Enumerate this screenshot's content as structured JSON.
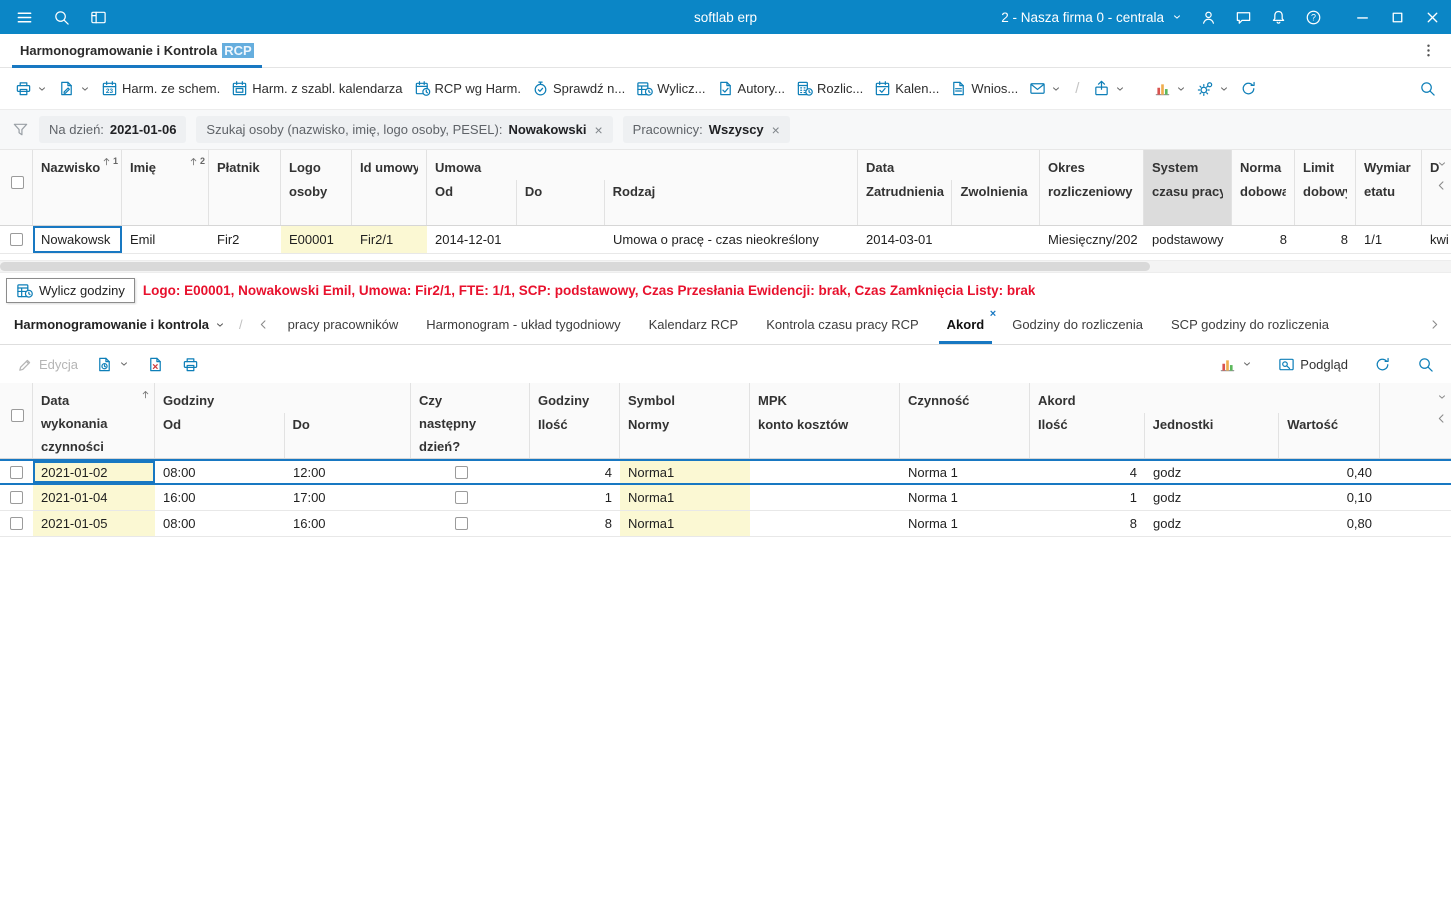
{
  "topbar": {
    "title": "softlab erp",
    "company_selector": "2 - Nasza firma 0 - centrala"
  },
  "window_tab": {
    "label": "Harmonogramowanie i Kontrola",
    "label_highlight": "RCP"
  },
  "toolbar1": {
    "buttons": [
      {
        "name": "print",
        "icon": "printer",
        "label": "",
        "caret": true
      },
      {
        "name": "export",
        "icon": "page-edit",
        "label": "",
        "caret": true
      },
      {
        "name": "harm-ze-schem",
        "icon": "calendar-23",
        "label": "Harm. ze schem.",
        "caret": false
      },
      {
        "name": "harm-z-szabl-kalendarza",
        "icon": "calendar-template",
        "label": "Harm. z szabl. kalendarza",
        "caret": false
      },
      {
        "name": "rcp-wg-harm",
        "icon": "calendar-clock",
        "label": "RCP wg Harm.",
        "caret": false
      },
      {
        "name": "sprawdz",
        "icon": "stopwatch-check",
        "label": "Sprawdź n...",
        "caret": false
      },
      {
        "name": "wylicz",
        "icon": "hours-calc",
        "label": "Wylicz...",
        "caret": false
      },
      {
        "name": "autoryzuj",
        "icon": "doc-check",
        "label": "Autory...",
        "caret": false
      },
      {
        "name": "rozlicz",
        "icon": "calc-clock",
        "label": "Rozlic...",
        "caret": false
      },
      {
        "name": "kalendarz",
        "icon": "calendar-check",
        "label": "Kalen...",
        "caret": false
      },
      {
        "name": "wnioski",
        "icon": "doc-request",
        "label": "Wnios...",
        "caret": false
      },
      {
        "name": "send",
        "icon": "send",
        "label": "",
        "caret": true
      },
      {
        "name": "divider",
        "icon": "divider",
        "label": "",
        "caret": false
      },
      {
        "name": "share",
        "icon": "share",
        "label": "",
        "caret": true
      },
      {
        "name": "chart",
        "icon": "chart",
        "label": "",
        "caret": true
      },
      {
        "name": "settings",
        "icon": "gears",
        "label": "",
        "caret": true
      },
      {
        "name": "refresh",
        "icon": "refresh",
        "label": "",
        "caret": false
      },
      {
        "name": "search",
        "icon": "search",
        "label": "",
        "caret": false
      }
    ]
  },
  "filters": [
    {
      "label": "Na dzień:",
      "value": "2021-01-06",
      "closable": false
    },
    {
      "label": "Szukaj osoby (nazwisko, imię, logo osoby, PESEL):",
      "value": "Nowakowski",
      "closable": true
    },
    {
      "label": "Pracownicy:",
      "value": "Wszyscy",
      "closable": true
    }
  ],
  "grid1": {
    "columns": {
      "nazwisko": [
        "Nazwisko"
      ],
      "imie": [
        "Imię"
      ],
      "platnik": [
        "Płatnik"
      ],
      "logo_osoby": [
        "Logo",
        "osoby"
      ],
      "id_umowy": [
        "Id umowy"
      ],
      "umowa_od": [
        "Od"
      ],
      "umowa_do": [
        "Do"
      ],
      "umowa_rodzaj": [
        "Rodzaj"
      ],
      "zatrudnienia": [
        "Zatrudnienia"
      ],
      "zwolnienia": [
        "Zwolnienia"
      ],
      "okres": [
        "Okres",
        "rozliczeniowy"
      ],
      "scp": [
        "System",
        "czasu pracy"
      ],
      "norma": [
        "Norma",
        "dobowa"
      ],
      "limit": [
        "Limit",
        "dobowy"
      ],
      "wymiar": [
        "Wymiar",
        "etatu"
      ],
      "d": [
        "D"
      ]
    },
    "groups": {
      "umowa": "Umowa",
      "data": "Data"
    },
    "sort_badges": {
      "nazwisko": "1",
      "imie": "2"
    },
    "rows": [
      {
        "nazwisko": "Nowakowsk",
        "imie": "Emil",
        "platnik": "Fir2",
        "logo_osoby": "E00001",
        "id_umowy": "Fir2/1",
        "umowa_od": "2014-12-01",
        "umowa_do": "",
        "umowa_rodzaj": "Umowa o pracę - czas nieokreślony",
        "zatrudnienia": "2014-03-01",
        "zwolnienia": "",
        "okres": "Miesięczny/202",
        "scp": "podstawowy",
        "norma": "8",
        "limit": "8",
        "wymiar": "1/1",
        "d": "kwi"
      }
    ]
  },
  "status": {
    "tooltip": "Wylicz godziny",
    "alert": "Logo: E00001, Nowakowski Emil, Umowa: Fir2/1, FTE: 1/1, SCP: podstawowy, Czas Przesłania Ewidencji: brak, Czas Zamknięcia Listy: brak"
  },
  "nav2": {
    "module": "Harmonogramowanie i kontrola",
    "tabs": [
      {
        "label": "pracy pracowników",
        "active": false,
        "closable": false
      },
      {
        "label": "Harmonogram - układ tygodniowy",
        "active": false,
        "closable": false
      },
      {
        "label": "Kalendarz RCP",
        "active": false,
        "closable": false
      },
      {
        "label": "Kontrola czasu pracy RCP",
        "active": false,
        "closable": false
      },
      {
        "label": "Akord",
        "active": true,
        "closable": true
      },
      {
        "label": "Godziny do rozliczenia",
        "active": false,
        "closable": false
      },
      {
        "label": "SCP godziny do rozliczenia",
        "active": false,
        "closable": false
      }
    ]
  },
  "toolbar2": {
    "edit_label": "Edycja",
    "preview_label": "Podgląd"
  },
  "grid2": {
    "columns": {
      "data_wykonania": [
        "Data",
        "wykonania",
        "czynności"
      ],
      "od": [
        "Od"
      ],
      "do": [
        "Do"
      ],
      "czy_nastepny": [
        "Czy",
        "następny",
        "dzień?"
      ],
      "ilosc_godzin": [
        "Godziny",
        "Ilość"
      ],
      "symbol_normy": [
        "Symbol",
        "Normy"
      ],
      "mpk": [
        "MPK",
        "konto kosztów"
      ],
      "czynnosc": [
        "Czynność"
      ],
      "akord_ilosc": [
        "Ilość"
      ],
      "jednostki": [
        "Jednostki"
      ],
      "wartosc": [
        "Wartość"
      ]
    },
    "groups": {
      "godziny": "Godziny",
      "akord": "Akord"
    },
    "rows": [
      {
        "selected": true,
        "data_wykonania": "2021-01-02",
        "od": "08:00",
        "do": "12:00",
        "czy_nastepny": false,
        "ilosc_godzin": "4",
        "symbol_normy": "Norma1",
        "mpk": "",
        "czynnosc": "Norma 1",
        "akord_ilosc": "4",
        "jednostki": "godz",
        "wartosc": "0,40"
      },
      {
        "selected": false,
        "data_wykonania": "2021-01-04",
        "od": "16:00",
        "do": "17:00",
        "czy_nastepny": false,
        "ilosc_godzin": "1",
        "symbol_normy": "Norma1",
        "mpk": "",
        "czynnosc": "Norma 1",
        "akord_ilosc": "1",
        "jednostki": "godz",
        "wartosc": "0,10"
      },
      {
        "selected": false,
        "data_wykonania": "2021-01-05",
        "od": "08:00",
        "do": "16:00",
        "czy_nastepny": false,
        "ilosc_godzin": "8",
        "symbol_normy": "Norma1",
        "mpk": "",
        "czynnosc": "Norma 1",
        "akord_ilosc": "8",
        "jednostki": "godz",
        "wartosc": "0,80"
      }
    ]
  },
  "colors": {
    "topbar_bg": "#0b86c6",
    "accent": "#1878c2",
    "toolbar_icon": "#0e7fb8",
    "cell_highlight": "#fbf8d3",
    "sorted_header_bg": "#dcdcdc",
    "alert_red": "#e8112d"
  }
}
